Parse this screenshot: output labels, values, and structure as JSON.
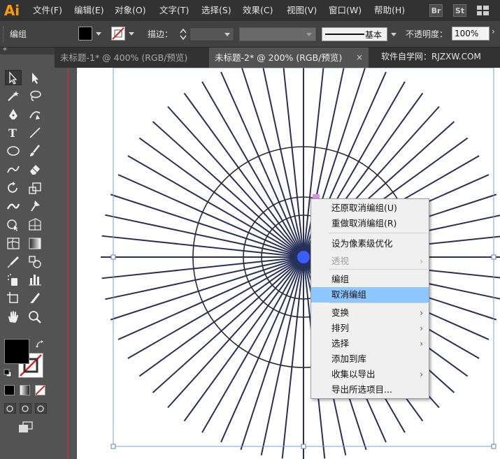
{
  "app": {
    "logo": "Ai"
  },
  "menubar": {
    "items": [
      "文件(F)",
      "编辑(E)",
      "对象(O)",
      "文字(T)",
      "选择(S)",
      "效果(C)",
      "视图(V)",
      "窗口(W)",
      "帮助(H)"
    ],
    "bridge_label": "Br",
    "stock_label": "St"
  },
  "controlbar": {
    "object_label": "编组",
    "stroke_label": "描边：",
    "stroke_style_label": "基本",
    "opacity_label": "不透明度：",
    "opacity_value": "100%"
  },
  "tabs": [
    {
      "label": "未标题-1* @ 400% (RGB/预览)",
      "active": false
    },
    {
      "label": "未标题-2* @ 200% (RGB/预览)",
      "active": true
    }
  ],
  "tab_close": "×",
  "watermark": "软件自学网：RJZXW.COM",
  "toolpanel": {
    "collapse": "«"
  },
  "context_menu": {
    "items": [
      {
        "label": "还原取消编组(U)"
      },
      {
        "label": "重做取消编组(R)"
      },
      {
        "label": "设为像素级优化"
      },
      {
        "label": "透视",
        "disabled": true,
        "submenu": true
      },
      {
        "label": "编组"
      },
      {
        "label": "取消编组",
        "highlighted": true
      },
      {
        "label": "变换",
        "submenu": true
      },
      {
        "label": "排列",
        "submenu": true
      },
      {
        "label": "选择",
        "submenu": true
      },
      {
        "label": "添加到库"
      },
      {
        "label": "收集以导出",
        "submenu": true
      },
      {
        "label": "导出所选项目..."
      }
    ],
    "submenu_arrow": "›"
  },
  "colors": {
    "accent": "#ff9a00",
    "line": "#27305a",
    "menu_highlight": "#8ec6ff"
  }
}
